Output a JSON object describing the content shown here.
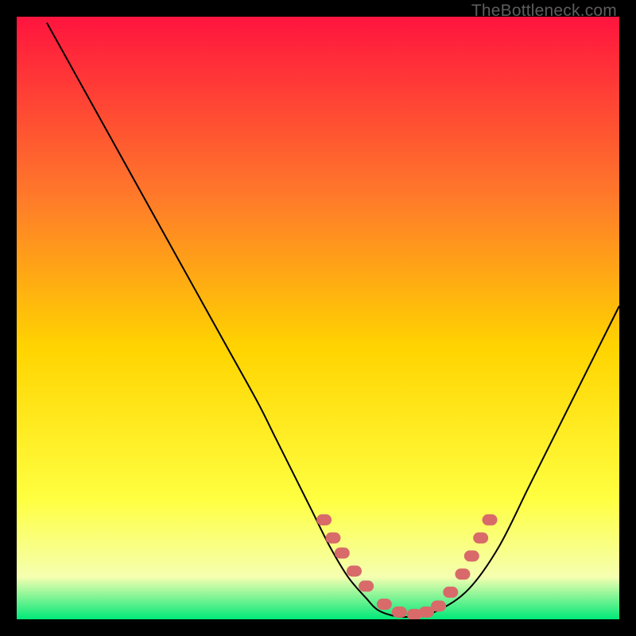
{
  "watermark": "TheBottleneck.com",
  "colors": {
    "gradient_top": "#ff143e",
    "gradient_mid1": "#ff7a2a",
    "gradient_mid2": "#ffd400",
    "gradient_mid3": "#ffff40",
    "gradient_mid4": "#f5ffb0",
    "gradient_bottom": "#00e878",
    "curve": "#000000",
    "marker": "#d86a6a",
    "frame_bg": "#000000"
  },
  "chart_data": {
    "type": "line",
    "title": "",
    "xlabel": "",
    "ylabel": "",
    "xlim": [
      0,
      100
    ],
    "ylim": [
      0,
      100
    ],
    "series": [
      {
        "name": "bottleneck-curve",
        "x": [
          5,
          10,
          15,
          20,
          25,
          30,
          35,
          40,
          43,
          46,
          49,
          52,
          55,
          58,
          60,
          63,
          66,
          70,
          75,
          80,
          85,
          90,
          95,
          100
        ],
        "y": [
          99,
          90,
          81,
          72,
          63,
          54,
          45,
          36,
          30,
          24,
          18,
          12,
          7,
          3.5,
          1.5,
          0.5,
          0.5,
          1.5,
          5,
          12,
          22,
          32,
          42,
          52
        ]
      }
    ],
    "markers": {
      "name": "highlight-points",
      "x": [
        51,
        52.5,
        54,
        56,
        58,
        61,
        63.5,
        66,
        68,
        70,
        72,
        74,
        75.5,
        77,
        78.5
      ],
      "y": [
        16.5,
        13.5,
        11,
        8,
        5.5,
        2.5,
        1.2,
        0.8,
        1.2,
        2.2,
        4.5,
        7.5,
        10.5,
        13.5,
        16.5
      ]
    }
  }
}
